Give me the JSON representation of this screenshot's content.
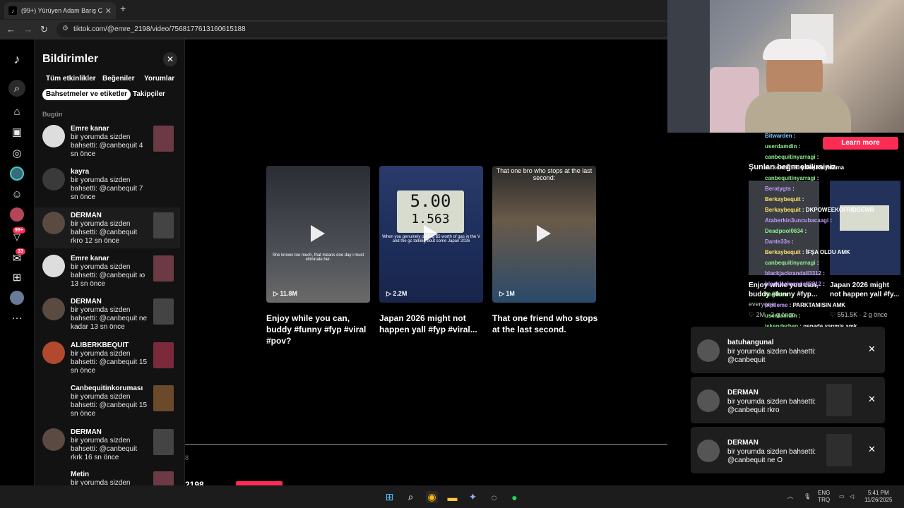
{
  "browser": {
    "tab_title": "(99+) Yürüyen Adam Barış Can",
    "tab_close": "✕",
    "new_tab": "+",
    "url": "tiktok.com/@emre_2198/video/7568177613160615188"
  },
  "rail": {
    "badge_count": "99+",
    "inbox_count": "33",
    "more": "···"
  },
  "panel": {
    "title": "Bildirimler",
    "close": "✕",
    "chips": [
      "Tüm etkinlikler",
      "Beğeniler",
      "Yorumlar",
      "Bahsetmeler ve etiketler",
      "Takipçiler"
    ],
    "section": "Bugün",
    "items": [
      {
        "name": "Emre kanar",
        "msg": "bir yorumda sizden bahsetti: @canbequit 4 sn önce"
      },
      {
        "name": "kayra",
        "msg": "bir yorumda sizden bahsetti: @canbequit 7 sn önce"
      },
      {
        "name": "DERMAN",
        "msg": "bir yorumda sizden bahsetti: @canbequit rkro 12 sn önce"
      },
      {
        "name": "Emre kanar",
        "msg": "bir yorumda sizden bahsetti: @canbequit ıo 13 sn önce"
      },
      {
        "name": "DERMAN",
        "msg": "bir yorumda sizden bahsetti: @canbequit ne kadar 13 sn önce"
      },
      {
        "name": "ALIBERKBEQUIT",
        "msg": "bir yorumda sizden bahsetti: @canbequit 15 sn önce"
      },
      {
        "name": "Canbequitinkoruması",
        "msg": "bir yorumda sizden bahsetti: @canbequit 15 sn önce"
      },
      {
        "name": "DERMAN",
        "msg": "bir yorumda sizden bahsetti: @canbequit rkrk 16 sn önce"
      },
      {
        "name": "Metin",
        "msg": "bir yorumda sizden"
      }
    ]
  },
  "main": {
    "videos": [
      {
        "views": "11.8M",
        "caption": "Enjoy while you can, buddy #funny #fyp #viral #pov?",
        "overlay": "She knows too much, that means one day i must eliminate her."
      },
      {
        "views": "2.2M",
        "caption": "Japan 2026 might not happen yall #fyp #viral...",
        "overlay": "When you genuinely putting $5 worth of gas in the V and the gc talking bout some Japan 2026",
        "gas_amount": "5.00",
        "gas_gal": "1.563"
      },
      {
        "views": "1M",
        "caption": "That one friend who stops at the last second.",
        "overlay": "That one bro who stops at the last second:"
      }
    ],
    "bottom_num": "2198",
    "left_num": "8"
  },
  "overlay": {
    "learn_more": "Learn more",
    "suggest": "Şunları beğenebilirsiniz",
    "chat": [
      {
        "user": "Bitwarden",
        "msg": ":",
        "color": "#7ec8ff"
      },
      {
        "user": "userdamdin",
        "msg": ":",
        "color": "#8ef08e"
      },
      {
        "user": "canbequitinyarragi",
        "msg": ":",
        "color": "#8ef08e"
      },
      {
        "user": "mckenzie120",
        "msg": "yakışıklı yalama",
        "color": "#ccc"
      },
      {
        "user": "canbequitinyarragi",
        "msg": ":",
        "color": "#8ef08e"
      },
      {
        "user": "Beratygts",
        "msg": ":",
        "color": "#c49bff"
      },
      {
        "user": "Berkaybequit",
        "msg": ":",
        "color": "#ffe066"
      },
      {
        "user": "Berkaybequit",
        "msg": ": DKPOWEEKOFRIDGEWR",
        "color": "#ffe066"
      },
      {
        "user": "Ataberkin3uncubacaagi",
        "msg": ":",
        "color": "#c49bff"
      },
      {
        "user": "Deadpool0634",
        "msg": ":",
        "color": "#8ef08e"
      },
      {
        "user": "Dante33s",
        "msg": ":",
        "color": "#c49bff"
      },
      {
        "user": "Berkaybequit",
        "msg": ": İFŞA OLDU AMK",
        "color": "#ffe066"
      },
      {
        "user": "canbequitinyarragi",
        "msg": ":",
        "color": "#8ef08e"
      },
      {
        "user": "blackjackrandall3312",
        "msg": ":",
        "color": "#c49bff"
      },
      {
        "user": "blackjackrandall3312",
        "msg": ":",
        "color": "#c49bff"
      },
      {
        "user": "tingursu",
        "msg": ":",
        "color": "#8ef08e"
      },
      {
        "user": "pipileme",
        "msg": ": PARKTAMISIN AMK",
        "color": "#c49bff"
      },
      {
        "user": "userdamdin",
        "msg": ":",
        "color": "#8ef08e"
      },
      {
        "user": "iskenderbeg",
        "msg": ": genede yapmis amk",
        "color": "#8ef08e"
      },
      {
        "user": "batuhangunal",
        "msg": ": Ruhi cenet son video",
        "color": "#c49bff"
      },
      {
        "user": "Scarecrow",
        "msg": ": yarram yürüyor",
        "color": "#8ef08e"
      }
    ],
    "sug_cards": [
      {
        "caption": "Enjoy while you can, buddy #funny #fyp...",
        "likes": "2M",
        "time": "2 g önce",
        "views_extra": "everyone..."
      },
      {
        "caption": "Japan 2026 might not happen yall #fy...",
        "likes": "551.5K",
        "time": "2 g önce"
      }
    ]
  },
  "toasts": [
    {
      "name": "batuhangunal",
      "msg": "bir yorumda sizden bahsetti: @canbequit"
    },
    {
      "name": "DERMAN",
      "msg": "bir yorumda sizden bahsetti: @canbequit rkro"
    },
    {
      "name": "DERMAN",
      "msg": "bir yorumda sizden bahsetti: @canbequit ne O"
    }
  ],
  "taskbar": {
    "lang": "ENG",
    "lang2": "TRQ",
    "time": "5:41 PM",
    "date": "11/26/2025"
  }
}
